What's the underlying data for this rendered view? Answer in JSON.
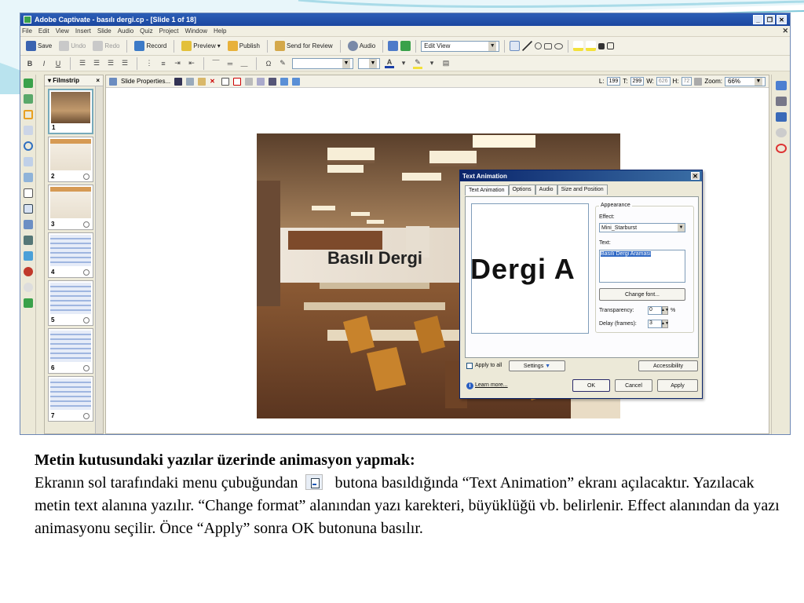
{
  "app": {
    "title": "Adobe Captivate - basılı dergi.cp - [Slide 1 of 18]",
    "menu": [
      "File",
      "Edit",
      "View",
      "Insert",
      "Slide",
      "Audio",
      "Quiz",
      "Project",
      "Window",
      "Help"
    ],
    "toolbar": {
      "save": "Save",
      "undo": "Undo",
      "redo": "Redo",
      "record": "Record",
      "preview": "Preview",
      "publish": "Publish",
      "send_for_review": "Send for Review",
      "audio": "Audio",
      "view_select": "Edit View"
    },
    "format_bar": {
      "bold": "B",
      "italic": "I",
      "underline": "U"
    }
  },
  "filmstrip": {
    "title": "Filmstrip",
    "close": "×",
    "slides": [
      "1",
      "2",
      "3",
      "4",
      "5",
      "6",
      "7"
    ]
  },
  "canvas_toolbar": {
    "slide_properties": "Slide Properties...",
    "l_label": "L:",
    "l_value": "199",
    "t_label": "T:",
    "t_value": "299",
    "w_label": "W:",
    "w_value": "626",
    "h_label": "H:",
    "h_value": "72",
    "zoom_label": "Zoom:",
    "zoom_value": "66%"
  },
  "slide_caption": "Basılı Dergi",
  "dialog": {
    "title": "Text Animation",
    "tabs": [
      "Text Animation",
      "Options",
      "Audio",
      "Size and Position"
    ],
    "preview_text": "Dergi A",
    "appearance_legend": "Appearance",
    "effect_label": "Effect:",
    "effect_value": "Mini_Starburst",
    "text_label": "Text:",
    "text_value": "Basılı Dergi Araması",
    "change_font": "Change font...",
    "transparency_label": "Transparency:",
    "transparency_value": "0",
    "transparency_unit": "%",
    "delay_label": "Delay (frames):",
    "delay_value": "3",
    "apply_to_all": "Apply to all",
    "settings": "Settings",
    "accessibility": "Accessibility",
    "learn_more": "Learn more...",
    "ok": "OK",
    "cancel": "Cancel",
    "apply": "Apply"
  },
  "description": {
    "heading": "Metin kutusundaki yazılar üzerinde animasyon yapmak:",
    "line1_a": "Ekranın sol tarafındaki menu çubuğundan",
    "line1_b": "butona basıldığında “Text Animation” ekranı açılacaktır. Yazılacak metin text alanına yazılır.  “Change format” alanından yazı karekteri, büyüklüğü vb. belirlenir. Effect alanından da yazı animasyonu seçilir.  Önce “Apply” sonra OK butonuna basılır.",
    "icon_name": "text-animation-icon"
  },
  "colors": {
    "title_bar": "#1b47a0",
    "window_bg": "#ece9d8",
    "deco_teal": "#7fc7d9"
  }
}
